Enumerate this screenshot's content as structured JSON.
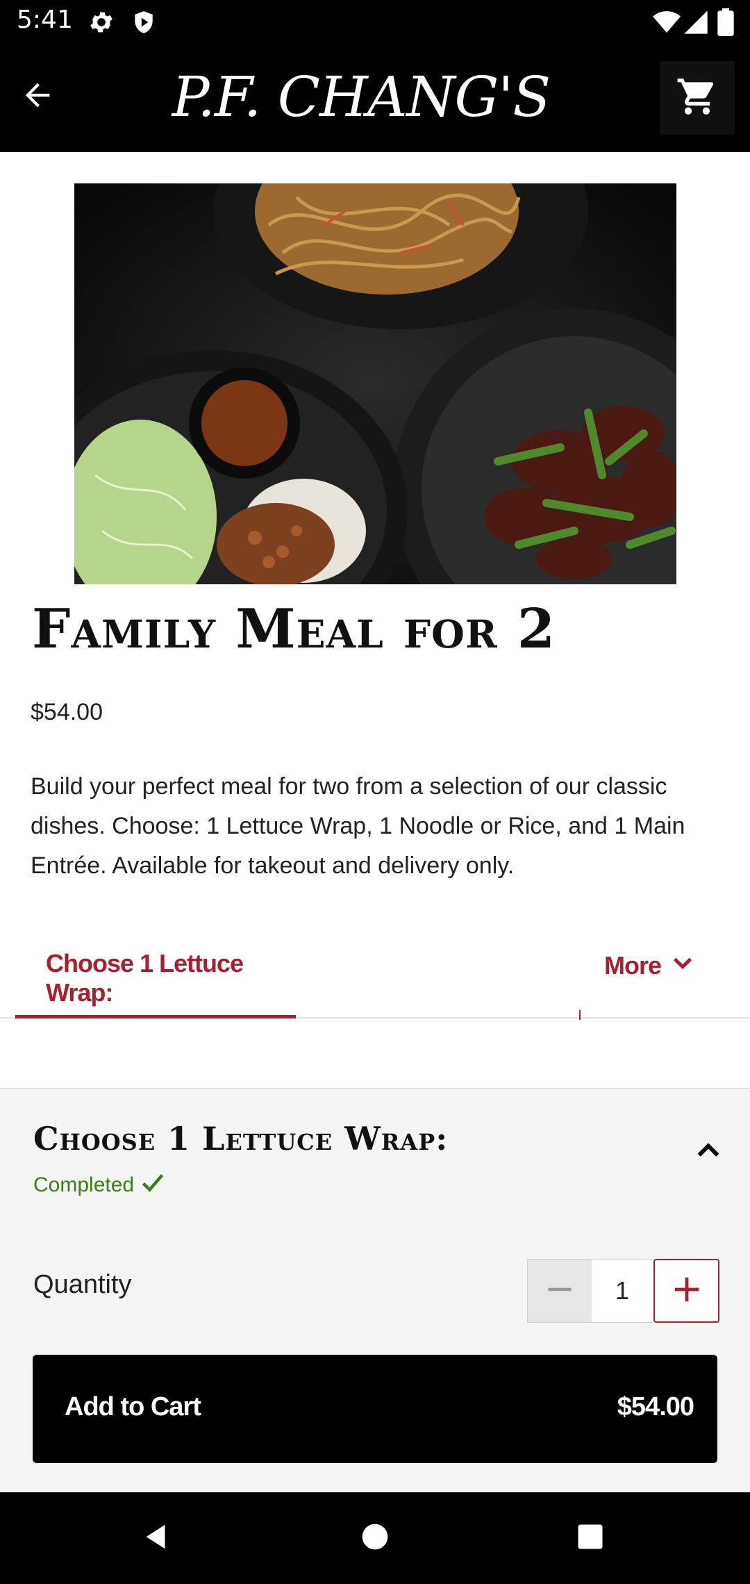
{
  "status_bar": {
    "time": "5:41",
    "icons": [
      "settings-icon",
      "shield-play-icon",
      "wifi-icon",
      "signal-icon",
      "battery-icon"
    ]
  },
  "app_bar": {
    "logo_text": "P.F. CHANG'S",
    "icons": [
      "back-arrow-icon",
      "cart-icon"
    ]
  },
  "item": {
    "title": "Family Meal for 2",
    "price": "$54.00",
    "description": "Build your perfect meal for two from a selection of our classic dishes. Choose: 1 Lettuce Wrap, 1 Noodle or Rice, and 1 Main Entrée. Available for takeout and delivery only."
  },
  "tabs": {
    "active_label": "Choose 1 Lettuce Wrap:",
    "more_label": "More"
  },
  "section": {
    "title": "Choose 1 Lettuce Wrap:",
    "status": "Completed"
  },
  "quantity": {
    "label": "Quantity",
    "value": "1"
  },
  "cart_button": {
    "label": "Add to Cart",
    "total": "$54.00"
  },
  "colors": {
    "accent": "#a8202d",
    "success": "#3f7d1a",
    "bar": "#000000",
    "panel": "#f4f4f4"
  }
}
